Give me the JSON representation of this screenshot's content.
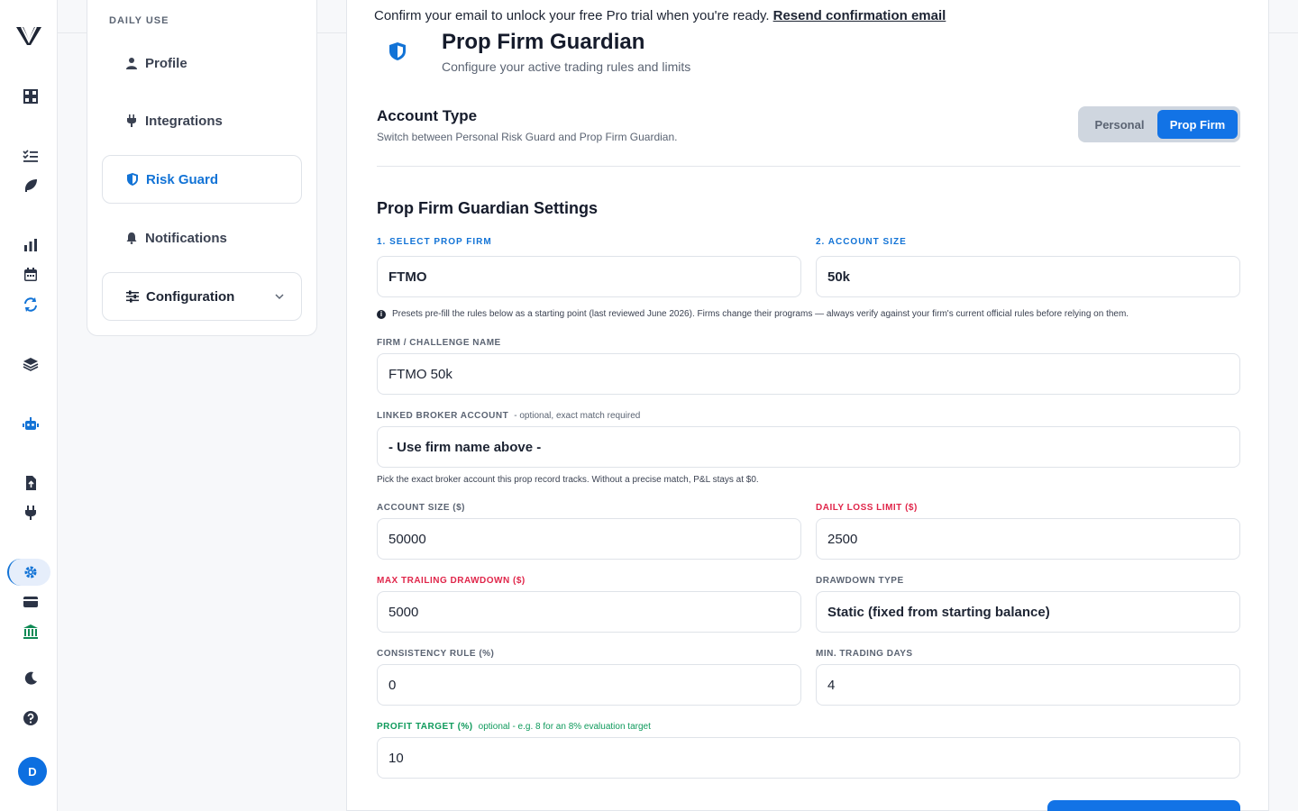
{
  "rail": {
    "icons": [
      "logo-icon",
      "dashboard-icon",
      "checklist-icon",
      "feather-icon",
      "bar-chart-icon",
      "calendar-icon",
      "sync-icon",
      "layers-icon",
      "robot-icon",
      "file-upload-icon",
      "plug-icon",
      "gear-icon",
      "credit-card-icon",
      "bank-icon",
      "moon-icon",
      "help-icon"
    ],
    "avatar": "D"
  },
  "subnav": {
    "section": "DAILY USE",
    "items": [
      {
        "label": "Profile",
        "icon": "user-icon"
      },
      {
        "label": "Integrations",
        "icon": "plug-icon"
      },
      {
        "label": "Risk Guard",
        "icon": "shield-icon",
        "active": true
      },
      {
        "label": "Notifications",
        "icon": "bell-icon"
      },
      {
        "label": "Configuration",
        "icon": "sliders-icon"
      }
    ]
  },
  "banner": {
    "text": "Confirm your email to unlock your free Pro trial when you're ready.",
    "link": "Resend confirmation email"
  },
  "page": {
    "title": "Prop Firm Guardian",
    "subtitle": "Configure your active trading rules and limits"
  },
  "account_type": {
    "title": "Account Type",
    "subtitle": "Switch between Personal Risk Guard and Prop Firm Guardian.",
    "options": [
      "Personal",
      "Prop Firm"
    ],
    "selected": "Prop Firm"
  },
  "settings": {
    "title": "Prop Firm Guardian Settings",
    "select_firm_label": "1. SELECT PROP FIRM",
    "select_firm_value": "FTMO",
    "account_size_label": "2. ACCOUNT SIZE",
    "account_size_value": "50k",
    "info_text": "Presets pre-fill the rules below as a starting point (last reviewed June 2026). Firms change their programs — always verify against your firm's current official rules before relying on them.",
    "challenge_label": "FIRM / CHALLENGE NAME",
    "challenge_value": "FTMO 50k",
    "broker_label": "LINKED BROKER ACCOUNT",
    "broker_note": "- optional, exact match required",
    "broker_value": "- Use firm name above -",
    "broker_hint": "Pick the exact broker account this prop record tracks. Without a precise match, P&L stays at $0.",
    "acct_size_label": "ACCOUNT SIZE ($)",
    "acct_size_value": "50000",
    "daily_loss_label": "DAILY LOSS LIMIT ($)",
    "daily_loss_value": "2500",
    "max_dd_label": "MAX TRAILING DRAWDOWN ($)",
    "max_dd_value": "5000",
    "dd_type_label": "DRAWDOWN TYPE",
    "dd_type_value": "Static (fixed from starting balance)",
    "consistency_label": "CONSISTENCY RULE (%)",
    "consistency_value": "0",
    "min_days_label": "MIN. TRADING DAYS",
    "min_days_value": "4",
    "profit_label": "PROFIT TARGET (%)",
    "profit_note": "optional - e.g. 8 for an 8% evaluation target",
    "profit_value": "10"
  }
}
